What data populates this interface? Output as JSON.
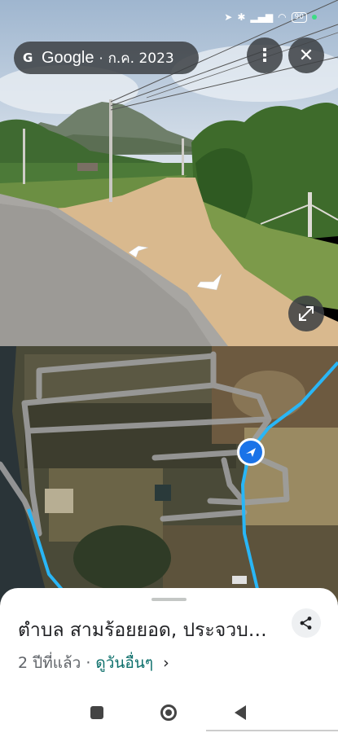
{
  "street_view": {
    "source_letter": "G",
    "brand": "Google",
    "separator": "·",
    "capture_date": "ก.ค. 2023",
    "more_icon": "more-vert-icon",
    "close_icon": "close-icon",
    "expand_icon": "expand-icon",
    "more_glyph": "⋮",
    "close_glyph": "✕"
  },
  "status_bar": {
    "battery": "90"
  },
  "place": {
    "title": "ตำบล สามร้อยยอด, ประจวบคีรีขันธ์",
    "age": "2 ปีที่แล้ว",
    "dot": "·",
    "more_dates": "ดูวันอื่นๆ",
    "chevron": "›"
  },
  "colors": {
    "accent_blue": "#1a73e8",
    "route_cyan": "#29b6f6",
    "link_teal": "#0b6e6a"
  }
}
